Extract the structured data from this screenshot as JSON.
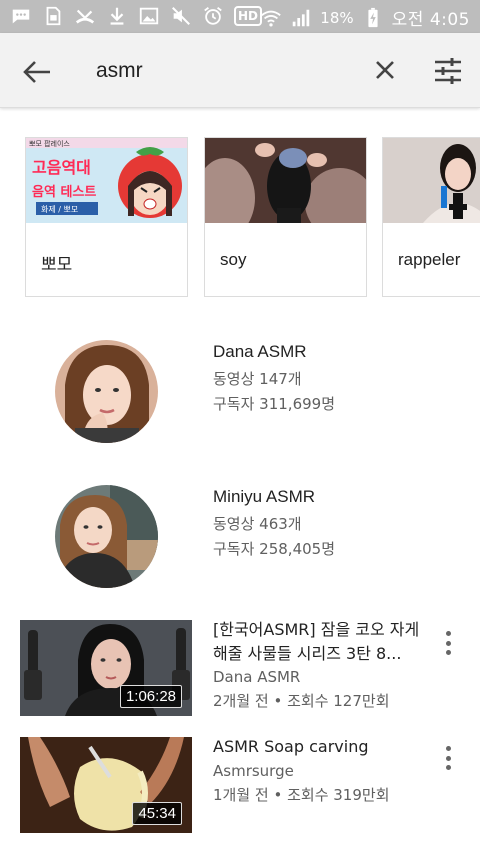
{
  "status_bar": {
    "battery": "18%",
    "clock": "오전 4:05",
    "hd_label": "HD",
    "icons": [
      "chat-icon",
      "sim-icon",
      "missed-call-icon",
      "download-icon",
      "image-icon",
      "mute-icon",
      "alarm-icon",
      "hd-icon",
      "wifi-icon",
      "signal-icon",
      "battery-charging-icon"
    ]
  },
  "search": {
    "query": "asmr",
    "back_icon": "arrow-back-icon",
    "clear_icon": "close-icon",
    "filter_icon": "filter-sliders-icon"
  },
  "playlists": [
    {
      "label": "뽀모",
      "thumb_text_1": "고음역대",
      "thumb_text_2": "음역 테스트",
      "thumb_tag": "화제 / 뽀모",
      "header_text": "뽀모 팝레이스"
    },
    {
      "label": "soy"
    },
    {
      "label": "rappeler"
    }
  ],
  "channels": [
    {
      "name": "Dana ASMR",
      "videos": "동영상 147개",
      "subscribers": "구독자 311,699명"
    },
    {
      "name": "Miniyu ASMR",
      "videos": "동영상 463개",
      "subscribers": "구독자 258,405명"
    }
  ],
  "videos": [
    {
      "title": "[한국어ASMR] 잠을 코오 자게 해줄 사물들 시리즈 3탄 8...",
      "channel": "Dana ASMR",
      "meta": "2개월 전 • 조회수 127만회",
      "duration": "1:06:28"
    },
    {
      "title": "ASMR Soap carving",
      "channel": "Asmrsurge",
      "meta": "1개월 전 • 조회수 319만회",
      "duration": "45:34"
    }
  ]
}
